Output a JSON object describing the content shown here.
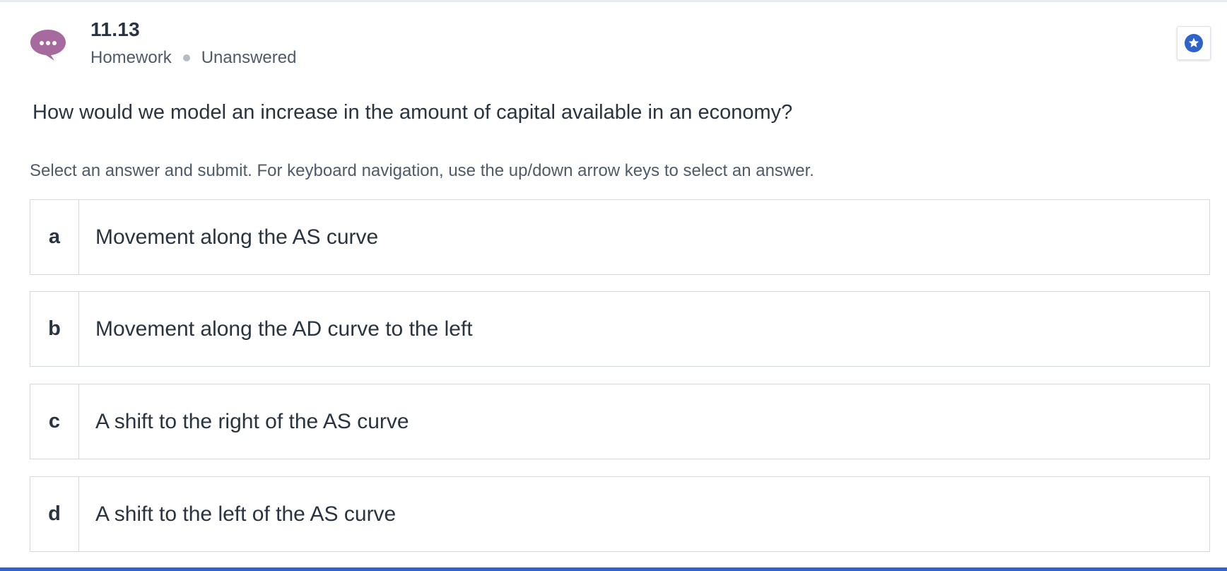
{
  "question": {
    "number": "11.13",
    "type": "Homework",
    "status": "Unanswered",
    "prompt": "How would we model an increase in the amount of capital available in an economy?",
    "instructions": "Select an answer and submit. For keyboard navigation, use the up/down arrow keys to select an answer."
  },
  "answers": [
    {
      "letter": "a",
      "label": "Movement along the AS curve"
    },
    {
      "letter": "b",
      "label": "Movement along the AD curve to the left"
    },
    {
      "letter": "c",
      "label": "A shift to the right of the AS curve"
    },
    {
      "letter": "d",
      "label": "A shift to the left of the AS curve"
    }
  ],
  "icons": {
    "question_icon": "chat-bubble-ellipsis-icon",
    "favorite_icon": "star-badge-icon"
  },
  "colors": {
    "chat_icon": "#a66a9f",
    "star_badge": "#2f63c9",
    "accent_bar": "#2f63c9",
    "text": "#2a3441",
    "muted_text": "#4f5b68"
  }
}
